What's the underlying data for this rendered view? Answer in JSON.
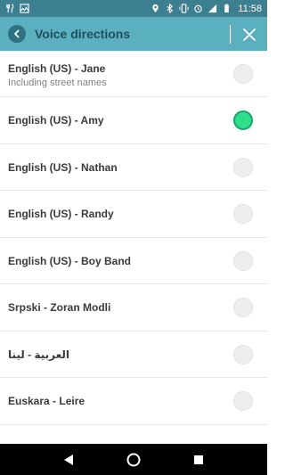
{
  "status_bar": {
    "time": "11:58",
    "left_icons": [
      "fork-knife-icon",
      "photo-icon"
    ],
    "right_icons": [
      "location-icon",
      "bluetooth-icon",
      "vibrate-icon",
      "alarm-icon",
      "signal-lte-icon",
      "battery-icon"
    ]
  },
  "header": {
    "title": "Voice directions",
    "back_icon": "chevron-left-icon",
    "close_icon": "close-icon"
  },
  "voices": [
    {
      "name": "English (US) - Jane",
      "subtitle": "Including street names",
      "selected": false
    },
    {
      "name": "English (US) - Amy",
      "subtitle": "",
      "selected": true
    },
    {
      "name": "English (US) - Nathan",
      "subtitle": "",
      "selected": false
    },
    {
      "name": "English (US) - Randy",
      "subtitle": "",
      "selected": false
    },
    {
      "name": "English (US) - Boy Band",
      "subtitle": "",
      "selected": false
    },
    {
      "name": "Srpski - Zoran Modli",
      "subtitle": "",
      "selected": false
    },
    {
      "name": "العربية - لينا",
      "subtitle": "",
      "selected": false
    },
    {
      "name": "Euskara - Leire",
      "subtitle": "",
      "selected": false
    }
  ],
  "nav_bar": {
    "buttons": [
      "back-triangle-icon",
      "home-circle-icon",
      "recents-square-icon"
    ]
  },
  "colors": {
    "status_bar": "#3b7f90",
    "app_bar": "#5bb0c0",
    "title_text": "#1e4f5a",
    "selected_radio": "#2ee08a"
  }
}
